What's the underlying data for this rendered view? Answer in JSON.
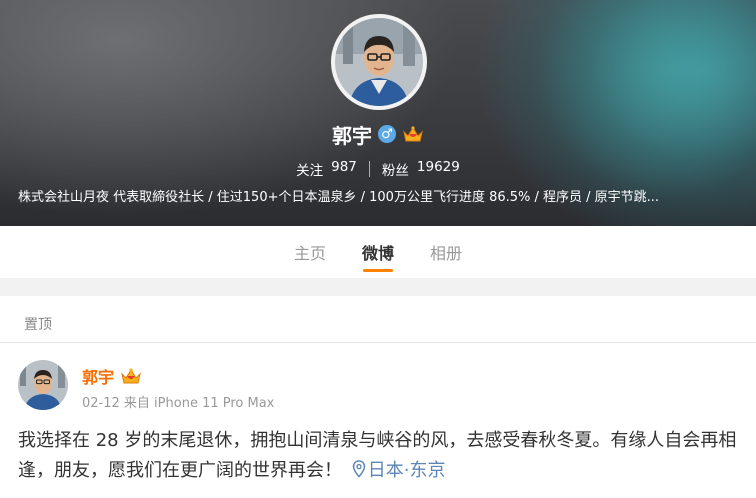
{
  "profile": {
    "name": "郭宇",
    "gender_icon": "male-icon",
    "badge_icon": "vip-crown-icon",
    "following_label": "关注",
    "following_count": "987",
    "followers_label": "粉丝",
    "followers_count": "19629",
    "bio": "株式会社山月夜 代表取締役社长 / 住过150+个日本温泉乡 / 100万公里飞行进度 86.5% / 程序员 / 原宇节跳..."
  },
  "tabs": [
    {
      "label": "主页",
      "active": false
    },
    {
      "label": "微博",
      "active": true
    },
    {
      "label": "相册",
      "active": false
    }
  ],
  "pinned": {
    "label": "置顶",
    "post": {
      "author": "郭宇",
      "date": "02-12",
      "source": "来自 iPhone 11 Pro Max",
      "text": "我选择在 28 岁的末尾退休，拥抱山间清泉与峡谷的风，去感受春秋冬夏。有缘人自会再相逢，朋友，愿我们在更广阔的世界再会！",
      "location": "日本·东京",
      "location_icon": "location-pin-icon"
    }
  },
  "colors": {
    "accent_orange": "#ff8200",
    "author_orange": "#f86e00",
    "location_blue": "#5b86b5",
    "male_blue": "#5ba9e6"
  }
}
